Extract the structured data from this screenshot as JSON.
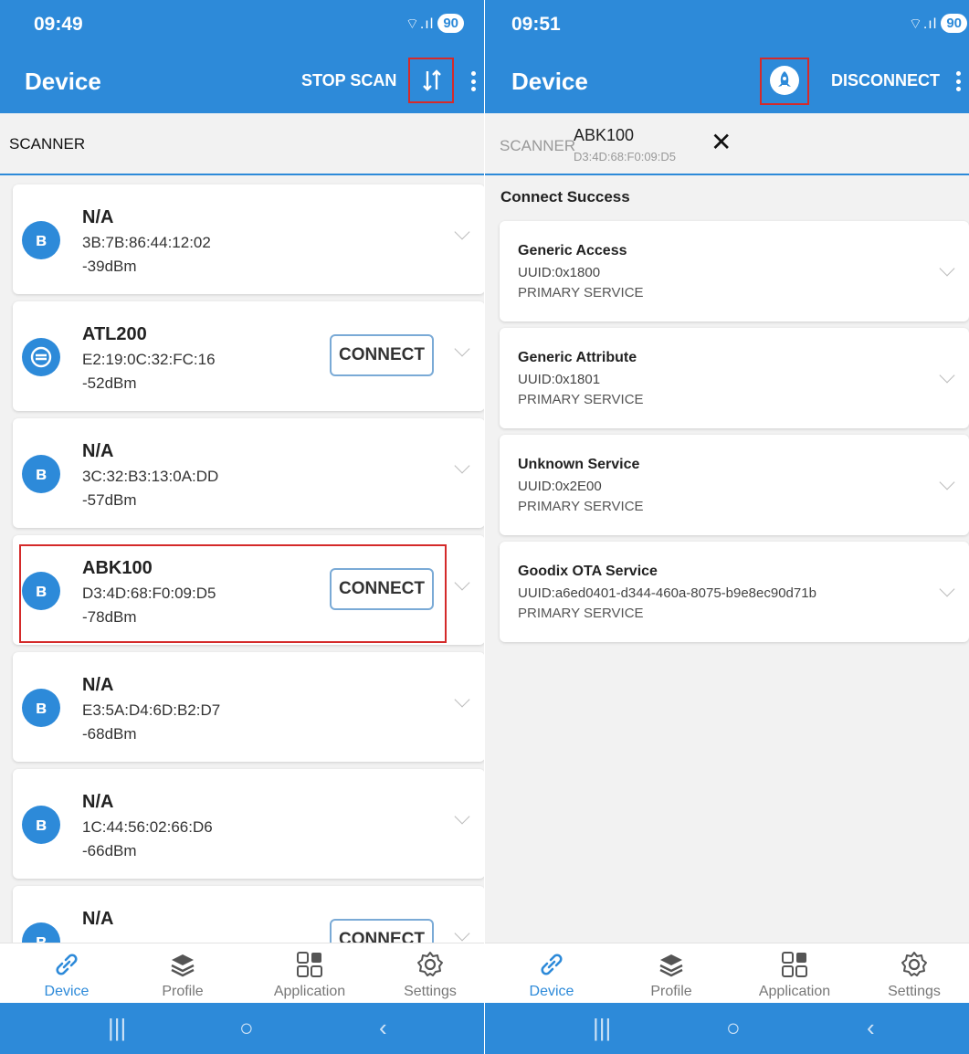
{
  "left": {
    "status": {
      "time": "09:49",
      "battery": "90"
    },
    "appbar": {
      "title": "Device",
      "stop_scan": "STOP SCAN"
    },
    "tab": {
      "scanner": "SCANNER"
    },
    "devices": [
      {
        "name": "N/A",
        "mac": "3B:7B:86:44:12:02",
        "rssi": "-39dBm",
        "icon": "bluetooth-icon"
      },
      {
        "name": "ATL200",
        "mac": "E2:19:0C:32:FC:16",
        "rssi": "-52dBm",
        "icon": "device-brand-icon",
        "connect": "CONNECT"
      },
      {
        "name": "N/A",
        "mac": "3C:32:B3:13:0A:DD",
        "rssi": "-57dBm",
        "icon": "bluetooth-icon"
      },
      {
        "name": "ABK100",
        "mac": "D3:4D:68:F0:09:D5",
        "rssi": "-78dBm",
        "icon": "bluetooth-icon",
        "connect": "CONNECT"
      },
      {
        "name": "N/A",
        "mac": "E3:5A:D4:6D:B2:D7",
        "rssi": "-68dBm",
        "icon": "bluetooth-icon"
      },
      {
        "name": "N/A",
        "mac": "1C:44:56:02:66:D6",
        "rssi": "-66dBm",
        "icon": "bluetooth-icon"
      },
      {
        "name": "N/A",
        "mac": "",
        "rssi": "",
        "icon": "bluetooth-icon",
        "connect": "CONNECT"
      }
    ]
  },
  "right": {
    "status": {
      "time": "09:51",
      "battery": "90"
    },
    "appbar": {
      "title": "Device",
      "disconnect": "DISCONNECT"
    },
    "tab": {
      "scanner": "SCANNER",
      "device_name": "ABK100",
      "device_mac": "D3:4D:68:F0:09:D5",
      "close": "✕"
    },
    "connect_status": "Connect Success",
    "services": [
      {
        "name": "Generic Access",
        "uuid": "UUID:0x1800",
        "type": "PRIMARY SERVICE"
      },
      {
        "name": "Generic Attribute",
        "uuid": "UUID:0x1801",
        "type": "PRIMARY SERVICE"
      },
      {
        "name": "Unknown Service",
        "uuid": "UUID:0x2E00",
        "type": "PRIMARY SERVICE"
      },
      {
        "name": "Goodix OTA Service",
        "uuid": "UUID:a6ed0401-d344-460a-8075-b9e8ec90d71b",
        "type": "PRIMARY SERVICE"
      }
    ]
  },
  "bottom_nav": {
    "device": "Device",
    "profile": "Profile",
    "application": "Application",
    "settings": "Settings"
  },
  "colors": {
    "primary": "#2d8ad9",
    "highlight": "#d42a2a",
    "background": "#f2f2f2"
  }
}
